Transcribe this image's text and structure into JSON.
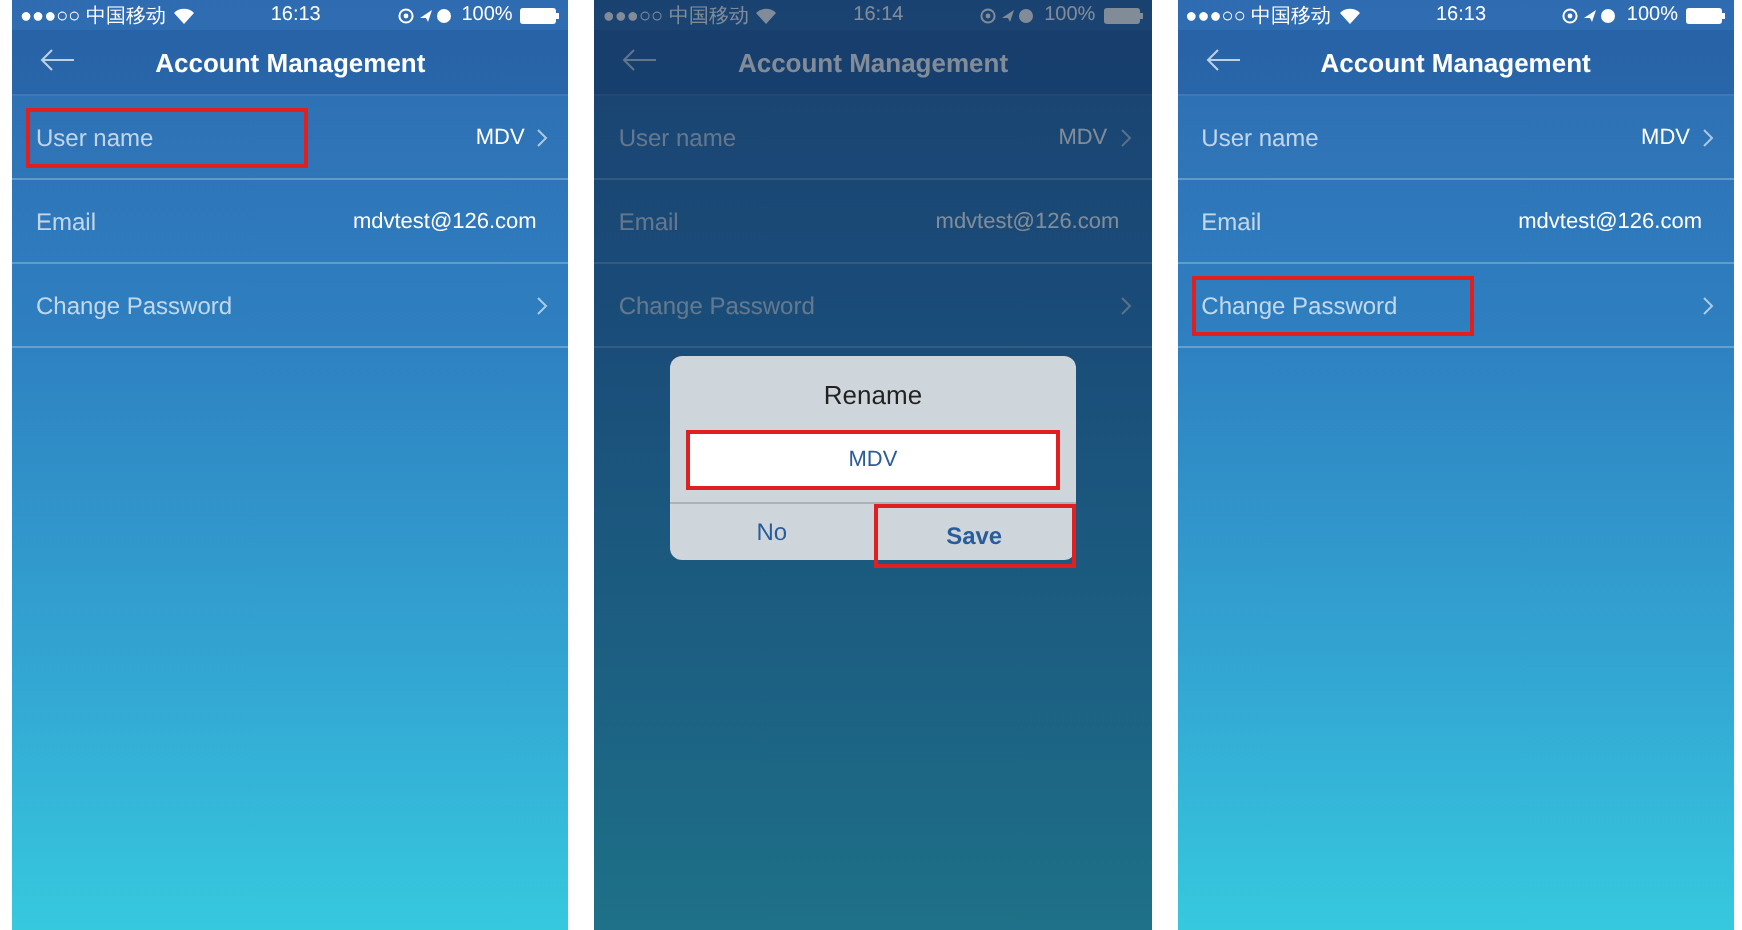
{
  "screens": [
    {
      "status_bar": {
        "carrier": "●●●○○ 中国移动",
        "time": "16:13",
        "battery": "100%"
      },
      "title": "Account Management",
      "dimmed": false,
      "rows": [
        {
          "label": "User name",
          "value": "MDV",
          "chevron": true,
          "highlighted": true
        },
        {
          "label": "Email",
          "value": "mdvtest@126.com",
          "chevron": false,
          "highlighted": false
        },
        {
          "label": "Change Password",
          "chevron": true,
          "highlighted": false
        }
      ]
    },
    {
      "status_bar": {
        "carrier": "●●●○○ 中国移动",
        "time": "16:14",
        "battery": "100%"
      },
      "title": "Account Management",
      "dimmed": true,
      "rows": [
        {
          "label": "User name",
          "value": "MDV",
          "chevron": true,
          "highlighted": false
        },
        {
          "label": "Email",
          "value": "mdvtest@126.com",
          "chevron": false,
          "highlighted": false
        },
        {
          "label": "Change Password",
          "chevron": true,
          "highlighted": false
        }
      ],
      "dialog": {
        "title": "Rename",
        "value": "MDV",
        "value_highlighted": true,
        "buttons": [
          {
            "label": "No",
            "highlighted": false
          },
          {
            "label": "Save",
            "highlighted": true
          }
        ]
      }
    },
    {
      "status_bar": {
        "carrier": "●●●○○ 中国移动",
        "time": "16:13",
        "battery": "100%"
      },
      "title": "Account Management",
      "dimmed": false,
      "rows": [
        {
          "label": "User name",
          "value": "MDV",
          "chevron": true,
          "highlighted": false
        },
        {
          "label": "Email",
          "value": "mdvtest@126.com",
          "chevron": false,
          "highlighted": false
        },
        {
          "label": "Change Password",
          "chevron": true,
          "highlighted": true
        }
      ]
    }
  ]
}
